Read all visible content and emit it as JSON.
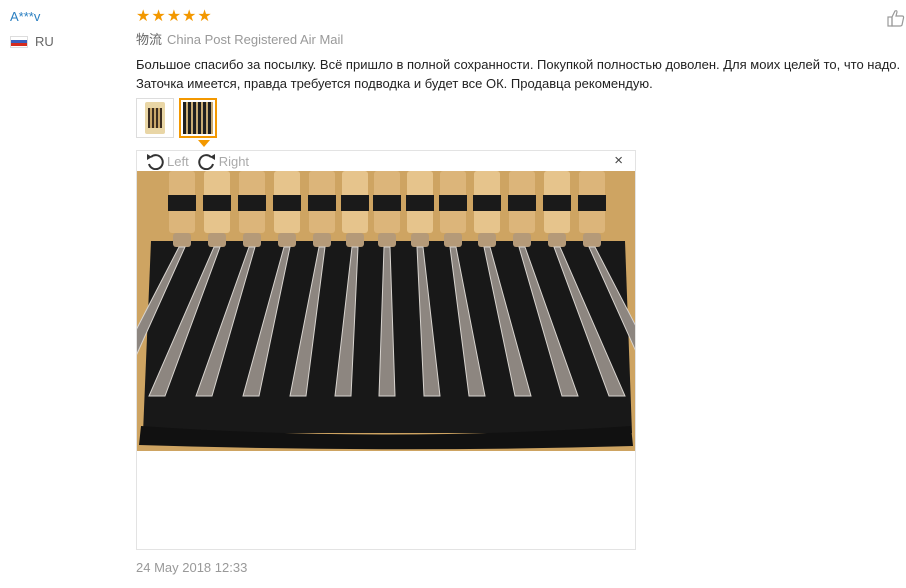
{
  "user": {
    "name": "A***v",
    "country_code": "RU"
  },
  "rating": {
    "stars": "★★★★★"
  },
  "logistics": {
    "label": "物流",
    "value": "China Post Registered Air Mail"
  },
  "review": {
    "text": "Большое спасибо за посылку. Всё пришло в полной сохранности. Покупкой полностью доволен. Для моих целей то, что надо. Заточка имеется, правда требуется подводка и будет все ОК. Продавца рекомендую."
  },
  "viewer": {
    "rotate_left": "Left",
    "rotate_right": "Right",
    "close": "×"
  },
  "date": "24 May 2018 12:33",
  "colors": {
    "accent": "#f39800",
    "username": "#2a7fc1",
    "muted": "#999999"
  },
  "icons": [
    "russia-flag-icon",
    "thumbs-up-icon",
    "rotate-left-icon",
    "rotate-right-icon",
    "close-icon"
  ]
}
